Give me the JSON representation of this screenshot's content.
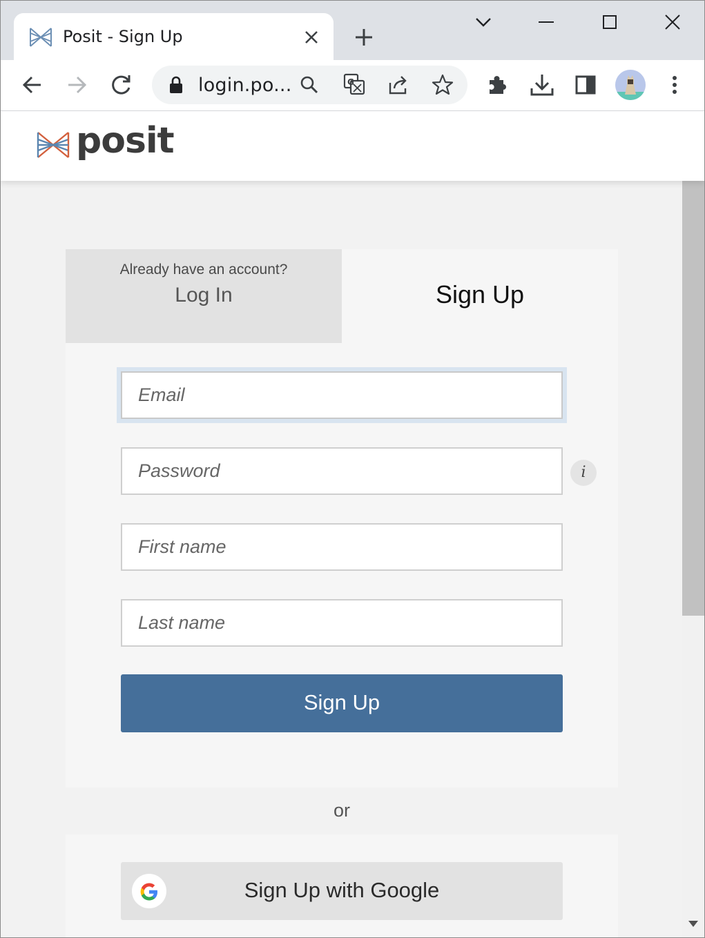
{
  "browser": {
    "tab_title": "Posit - Sign Up",
    "url_display": "login.po...",
    "icons": {
      "favicon": "posit-logo-icon",
      "close_tab": "close-icon",
      "new_tab": "plus-icon",
      "tab_search": "chevron-down-icon",
      "minimize": "minimize-icon",
      "maximize": "maximize-icon",
      "close_window": "close-icon",
      "back": "arrow-left-icon",
      "forward": "arrow-right-icon",
      "reload": "reload-icon",
      "lock": "lock-icon",
      "search": "search-icon",
      "translate": "translate-icon",
      "share": "share-icon",
      "bookmark": "star-icon",
      "extensions": "puzzle-icon",
      "downloads": "download-icon",
      "side_panel": "side-panel-icon",
      "profile": "avatar-icon",
      "menu": "kebab-menu-icon"
    }
  },
  "site": {
    "logo_text": "posit",
    "logo_tm": "™"
  },
  "auth": {
    "login_tab": {
      "prompt": "Already have an account?",
      "label": "Log In"
    },
    "signup_tab": {
      "label": "Sign Up"
    },
    "fields": {
      "email_placeholder": "Email",
      "password_placeholder": "Password",
      "first_name_placeholder": "First name",
      "last_name_placeholder": "Last name"
    },
    "info_glyph": "i",
    "submit_label": "Sign Up",
    "divider": "or",
    "google_label": "Sign Up with Google"
  },
  "colors": {
    "primary_button": "#456f9a",
    "tab_strip": "#dee1e6",
    "inactive_tab": "#e2e2e2",
    "card": "#f6f6f6"
  }
}
